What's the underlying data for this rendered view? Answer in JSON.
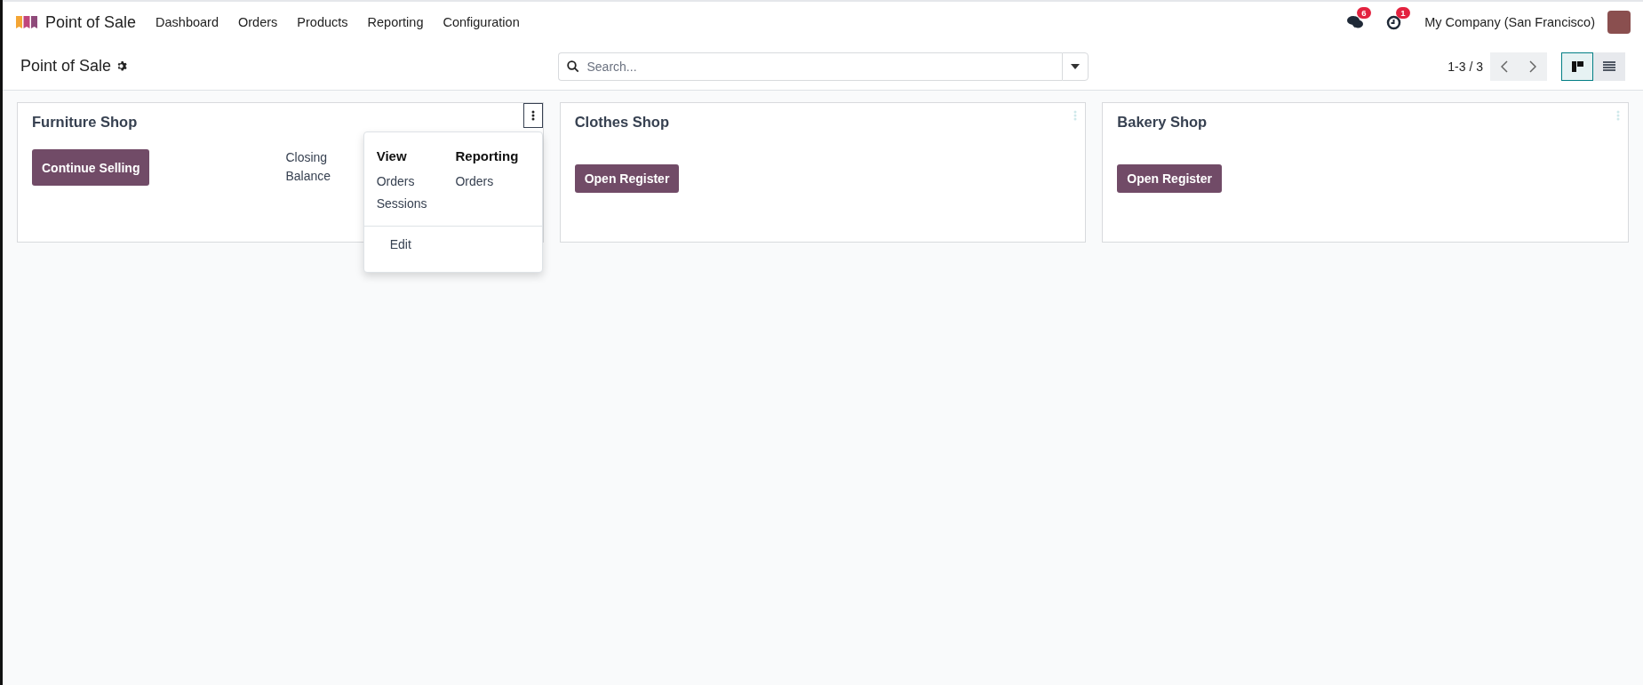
{
  "navbar": {
    "app_name": "Point of Sale",
    "menu": [
      "Dashboard",
      "Orders",
      "Products",
      "Reporting",
      "Configuration"
    ],
    "messages_count": "6",
    "activities_count": "1",
    "company": "My Company (San Francisco)"
  },
  "control_panel": {
    "title": "Point of Sale",
    "search": {
      "placeholder": "Search..."
    },
    "pager": "1-3 / 3",
    "views": [
      {
        "kind": "kanban",
        "selected": true
      },
      {
        "kind": "list",
        "selected": false
      }
    ]
  },
  "cards": [
    {
      "name": "Furniture Shop",
      "button": "Continue Selling",
      "info": "Closing\nBalance",
      "menu_open": true
    },
    {
      "name": "Clothes Shop",
      "button": "Open Register",
      "menu_open": false
    },
    {
      "name": "Bakery Shop",
      "button": "Open Register",
      "menu_open": false
    }
  ],
  "card_menu": {
    "sections": [
      {
        "title": "View",
        "items": [
          "Orders",
          "Sessions"
        ]
      },
      {
        "title": "Reporting",
        "items": [
          "Orders"
        ]
      }
    ],
    "footer_items": [
      "Edit"
    ]
  }
}
